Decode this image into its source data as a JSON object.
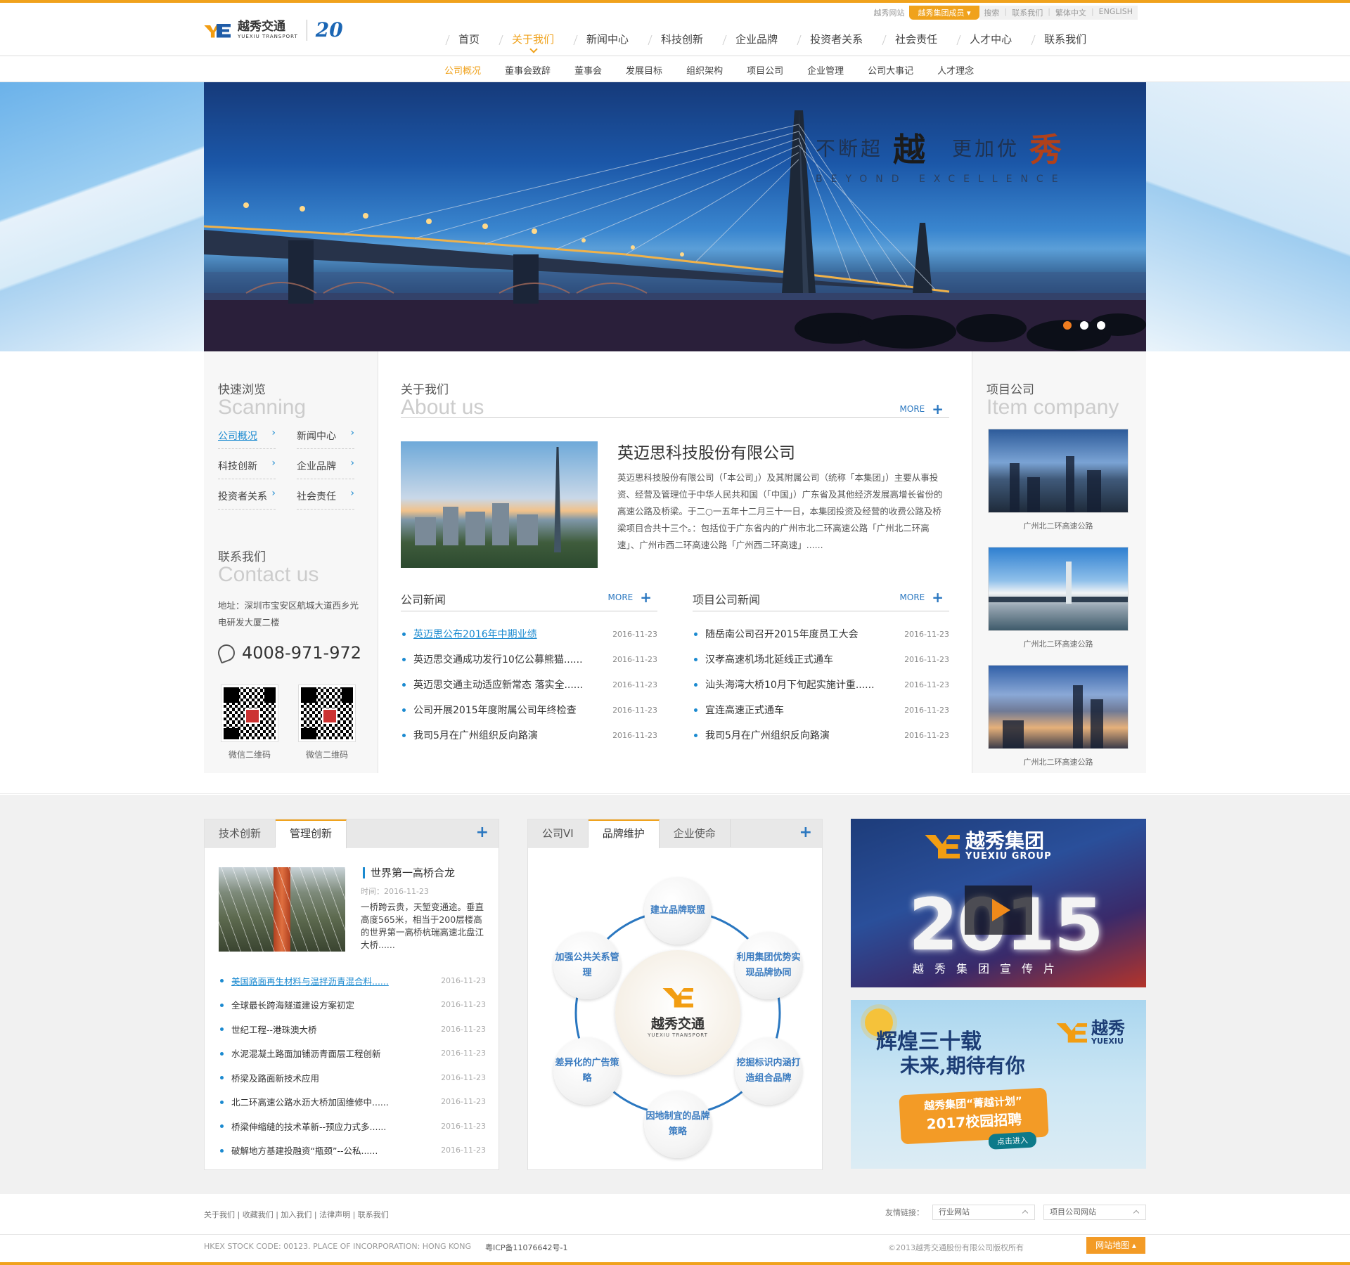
{
  "top_links": {
    "site": "越秀网站",
    "member": "越秀集团成员 ▾",
    "search": "搜索",
    "contact": "联系我们",
    "trad_chinese": "繁体中文",
    "english": "ENGLISH"
  },
  "logo": {
    "cn": "越秀交通",
    "en": "YUEXIU TRANSPORT",
    "anniversary": "20"
  },
  "main_nav": [
    "首页",
    "关于我们",
    "新闻中心",
    "科技创新",
    "企业品牌",
    "投资者关系",
    "社会责任",
    "人才中心",
    "联系我们"
  ],
  "sub_nav": [
    "公司概况",
    "董事会致辞",
    "董事会",
    "发展目标",
    "组织架构",
    "项目公司",
    "企业管理",
    "公司大事记",
    "人才理念"
  ],
  "banner": {
    "slogan_a": "不断超",
    "slogan_b": "越",
    "slogan_c": "更加优",
    "slogan_d": "秀",
    "slogan_en": "BEYOND  EXCELLENCE"
  },
  "quick": {
    "title_cn": "快速浏览",
    "title_en": "Scanning",
    "links": [
      "公司概况",
      "新闻中心",
      "科技创新",
      "企业品牌",
      "投资者关系",
      "社会责任"
    ]
  },
  "contact": {
    "title_cn": "联系我们",
    "title_en": "Contact us",
    "address": "地址：深圳市宝安区航城大道西乡光电研发大厦二楼",
    "phone": "4008-971-972",
    "qr1": "微信二维码",
    "qr2": "微信二维码"
  },
  "about": {
    "title_cn": "关于我们",
    "title_en": "About us",
    "more": "MORE",
    "company": "英迈思科技股份有限公司",
    "text": "英迈思科技股份有限公司（「本公司」）及其附属公司（统称「本集团」）主要从事投资、经营及管理位于中华人民共和国（「中国」）广东省及其他经济发展高增长省份的高速公路及桥梁。于二○一五年十二月三十一日，本集团投资及经营的收费公路及桥梁项目合共十三个。：包括位于广东省内的广州市北二环高速公路「广州北二环高速」、广州市西二环高速公路「广州西二环高速」......"
  },
  "company_news": {
    "title": "公司新闻",
    "more": "MORE",
    "items": [
      {
        "t": "英迈思公布2016年中期业绩",
        "d": "2016-11-23"
      },
      {
        "t": "英迈思交通成功发行10亿公募熊猫......",
        "d": "2016-11-23"
      },
      {
        "t": "英迈思交通主动适应新常态 落实全......",
        "d": "2016-11-23"
      },
      {
        "t": "公司开展2015年度附属公司年终检查",
        "d": "2016-11-23"
      },
      {
        "t": "我司5月在广州组织反向路演",
        "d": "2016-11-23"
      }
    ]
  },
  "project_news": {
    "title": "项目公司新闻",
    "more": "MORE",
    "items": [
      {
        "t": "随岳南公司召开2015年度员工大会",
        "d": "2016-11-23"
      },
      {
        "t": "汉孝高速机场北延线正式通车",
        "d": "2016-11-23"
      },
      {
        "t": "汕头海湾大桥10月下旬起实施计重......",
        "d": "2016-11-23"
      },
      {
        "t": "宜连高速正式通车",
        "d": "2016-11-23"
      },
      {
        "t": "我司5月在广州组织反向路演",
        "d": "2016-11-23"
      }
    ]
  },
  "project_company": {
    "title_cn": "项目公司",
    "title_en": "Item company",
    "cards": [
      "广州北二环高速公路",
      "广州北二环高速公路",
      "广州北二环高速公路"
    ]
  },
  "tech_box": {
    "tabs": [
      "技术创新",
      "管理创新"
    ],
    "feat_title": "世界第一高桥合龙",
    "feat_date": "时间：2016-11-23",
    "feat_desc": "一桥跨云贵，天堑变通途。垂直高度565米，相当于200层楼高的世界第一高桥杭瑞高速北盘江大桥......",
    "items": [
      {
        "t": "美国路面再生材料与温拌沥青混合料......",
        "d": "2016-11-23"
      },
      {
        "t": "全球最长跨海隧道建设方案初定",
        "d": "2016-11-23"
      },
      {
        "t": "世纪工程--港珠澳大桥",
        "d": "2016-11-23"
      },
      {
        "t": "水泥混凝土路面加铺沥青面层工程创新",
        "d": "2016-11-23"
      },
      {
        "t": "桥梁及路面新技术应用",
        "d": "2016-11-23"
      },
      {
        "t": "北二环高速公路水沥大桥加固维修中......",
        "d": "2016-11-23"
      },
      {
        "t": "桥梁伸缩缝的技术革新--预应力式多......",
        "d": "2016-11-23"
      },
      {
        "t": "破解地方基建投融资“瓶颈”--公私......",
        "d": "2016-11-23"
      }
    ]
  },
  "brand_box": {
    "tabs": [
      "公司VI",
      "品牌维护",
      "企业使命"
    ],
    "center_cn": "越秀交通",
    "center_en": "YUEXIU TRANSPORT",
    "nodes": [
      "建立品牌联盟",
      "利用集团优势实现品牌协同",
      "挖掘标识内涵打造组合品牌",
      "因地制宜的品牌策略",
      "差异化的广告策略",
      "加强公共关系管理"
    ]
  },
  "promo_video": {
    "brand_cn": "越秀集团",
    "brand_en": "YUEXIU GROUP",
    "year": "2015",
    "caption": "越秀集团宣传片"
  },
  "promo_recruit": {
    "line1": "辉煌三十载",
    "line2": "未来,期待有你",
    "badge1": "越秀集团“菁越计划”",
    "badge2": "2017校园招聘",
    "badge3": "点击进入",
    "brand_cn": "越秀",
    "brand_en": "YUEXIU"
  },
  "footer": {
    "links": "关于我们 | 收藏我们 | 加入我们 | 法律声明 | 联系我们",
    "friends_label": "友情链接：",
    "select1": "行业网站",
    "select2": "项目公司网站",
    "stock": "HKEX STOCK CODE: 00123. PLACE OF INCORPORATION: HONG KONG",
    "icp": "粤ICP备11076642号-1",
    "copyright": "©2013越秀交通股份有限公司版权所有",
    "sitemap": "网站地图 ▴"
  },
  "colors": {
    "accent": "#f0a21c",
    "link": "#1b8ad0"
  }
}
